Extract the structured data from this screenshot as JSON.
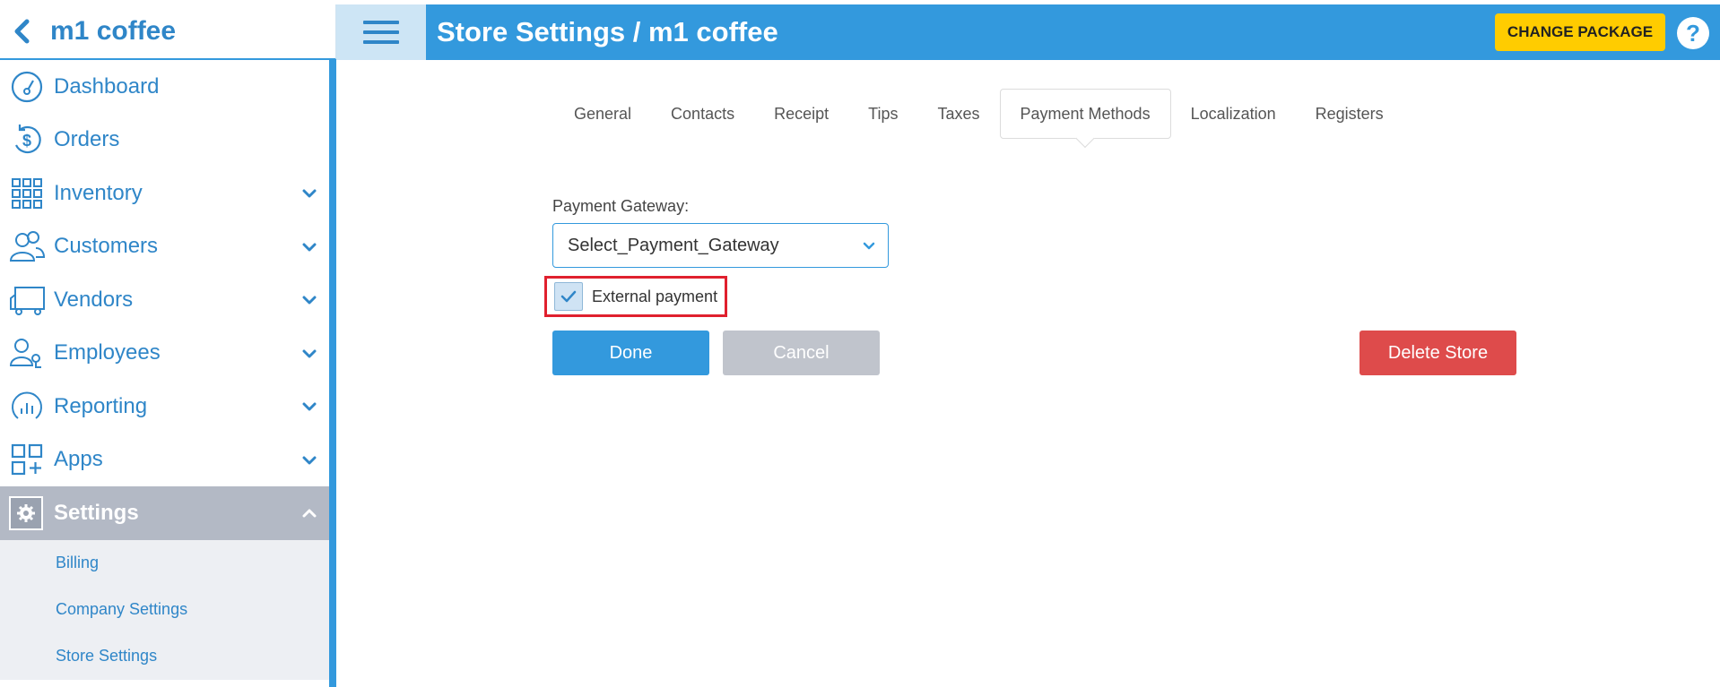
{
  "app": {
    "store_name": "m1 coffee",
    "page_title": "Store Settings / m1 coffee",
    "change_package_label": "CHANGE PACKAGE",
    "help_label": "?"
  },
  "sidebar": {
    "items": [
      {
        "label": "Dashboard",
        "icon": "dashboard-gauge-icon"
      },
      {
        "label": "Orders",
        "icon": "dollar-refresh-icon"
      },
      {
        "label": "Inventory",
        "icon": "grid-icon"
      },
      {
        "label": "Customers",
        "icon": "users-icon"
      },
      {
        "label": "Vendors",
        "icon": "truck-icon"
      },
      {
        "label": "Employees",
        "icon": "employee-icon"
      },
      {
        "label": "Reporting",
        "icon": "chart-icon"
      },
      {
        "label": "Apps",
        "icon": "apps-icon"
      },
      {
        "label": "Settings",
        "icon": "gear-icon"
      }
    ],
    "settings_sub": [
      {
        "label": "Billing"
      },
      {
        "label": "Company Settings"
      },
      {
        "label": "Store Settings"
      }
    ]
  },
  "tabs": [
    {
      "label": "General"
    },
    {
      "label": "Contacts"
    },
    {
      "label": "Receipt"
    },
    {
      "label": "Tips"
    },
    {
      "label": "Taxes"
    },
    {
      "label": "Payment Methods",
      "active": true
    },
    {
      "label": "Localization"
    },
    {
      "label": "Registers"
    }
  ],
  "form": {
    "gateway_label": "Payment Gateway:",
    "gateway_value": "Select_Payment_Gateway",
    "external_payment_label": "External payment",
    "external_payment_checked": true,
    "done_label": "Done",
    "cancel_label": "Cancel",
    "delete_label": "Delete Store"
  },
  "colors": {
    "primary": "#3399dd",
    "header_text": "#ffffff",
    "package_button": "#ffcc00",
    "delete_button": "#de4b4b",
    "cancel_button": "#c0c4cc",
    "highlight": "#e0202e",
    "active_nav": "#b3b9c5"
  }
}
